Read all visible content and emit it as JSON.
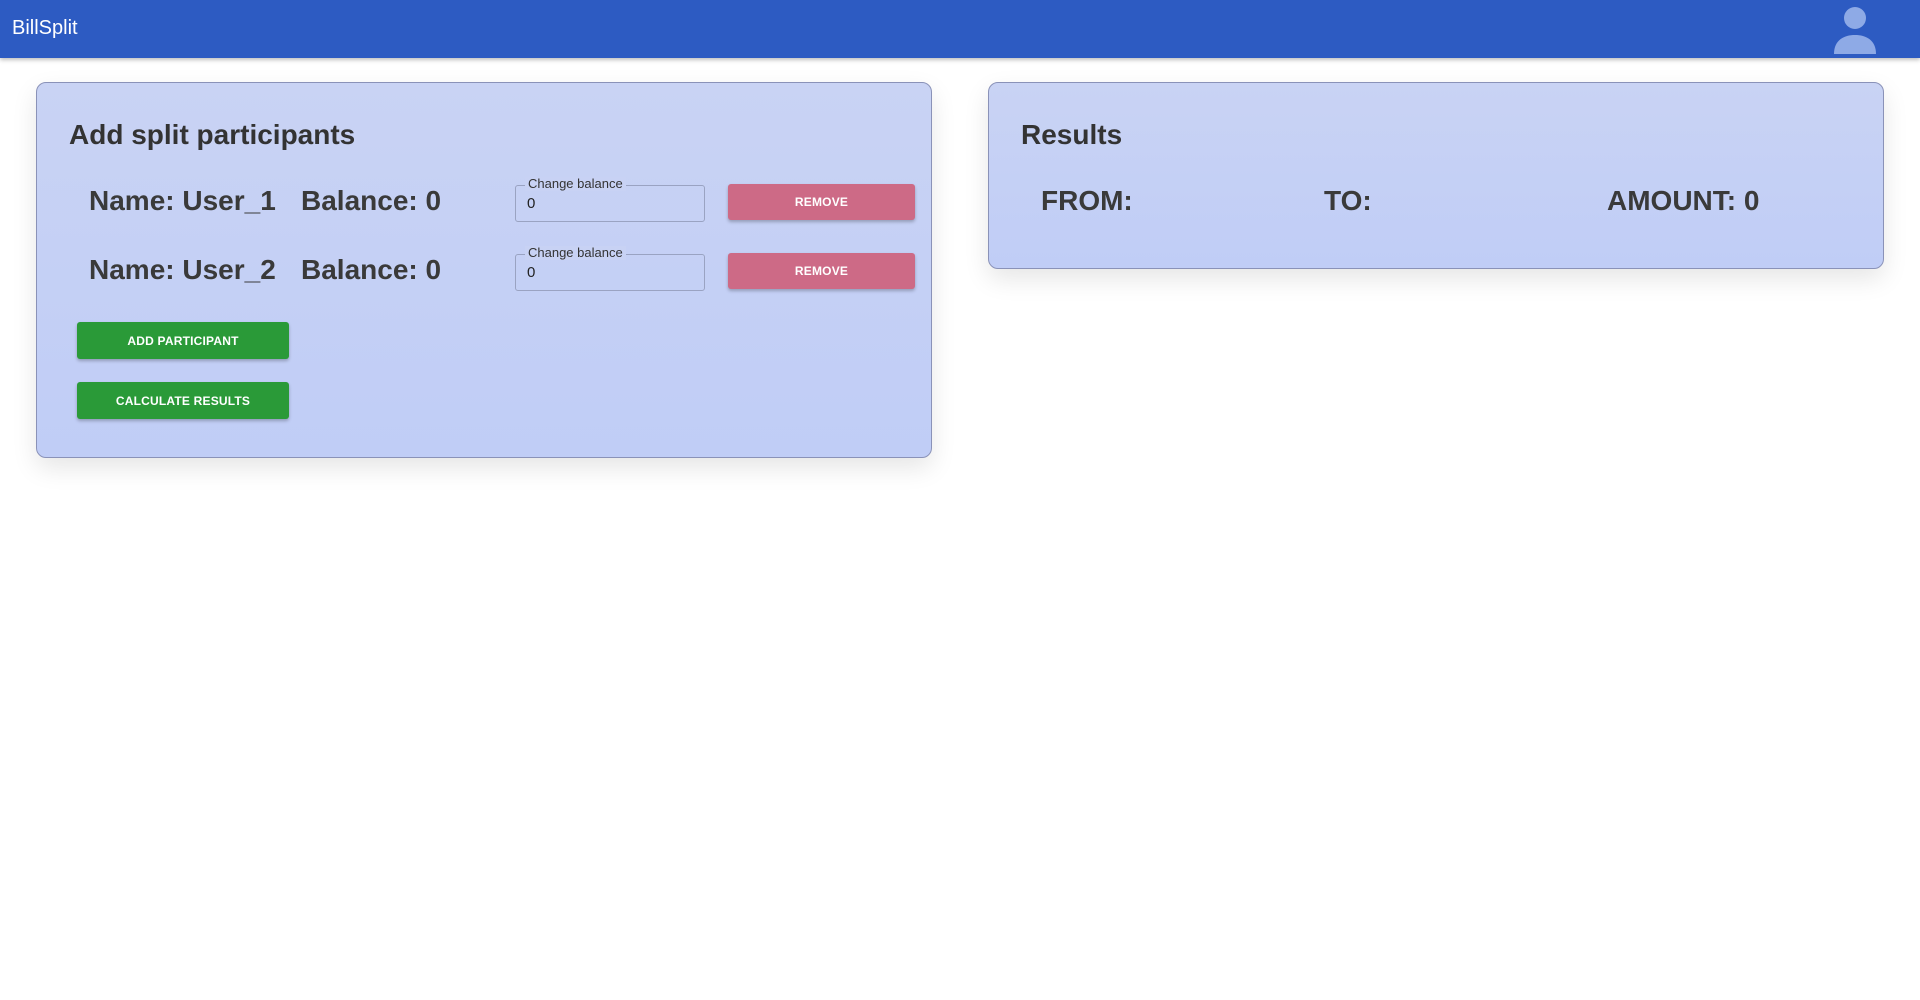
{
  "header": {
    "app_title": "BillSplit",
    "avatar_icon": "user-avatar-icon",
    "background_color": "#2d5bc2"
  },
  "participants_card": {
    "title": "Add split participants",
    "participants": [
      {
        "name_text": "Name: User_1",
        "balance_text": "Balance: 0",
        "field_label": "Change balance",
        "field_value": "0",
        "remove_label": "REMOVE"
      },
      {
        "name_text": "Name: User_2",
        "balance_text": "Balance: 0",
        "field_label": "Change balance",
        "field_value": "0",
        "remove_label": "REMOVE"
      }
    ],
    "add_participant_label": "ADD PARTICIPANT",
    "calculate_results_label": "CALCULATE RESULTS"
  },
  "results_card": {
    "title": "Results",
    "from_label": "FROM:",
    "to_label": "TO:",
    "amount_label": "AMOUNT: 0"
  },
  "colors": {
    "remove_button": "#cd6a86",
    "action_button": "#2a9a38",
    "card_background": "#c9d3f4"
  }
}
